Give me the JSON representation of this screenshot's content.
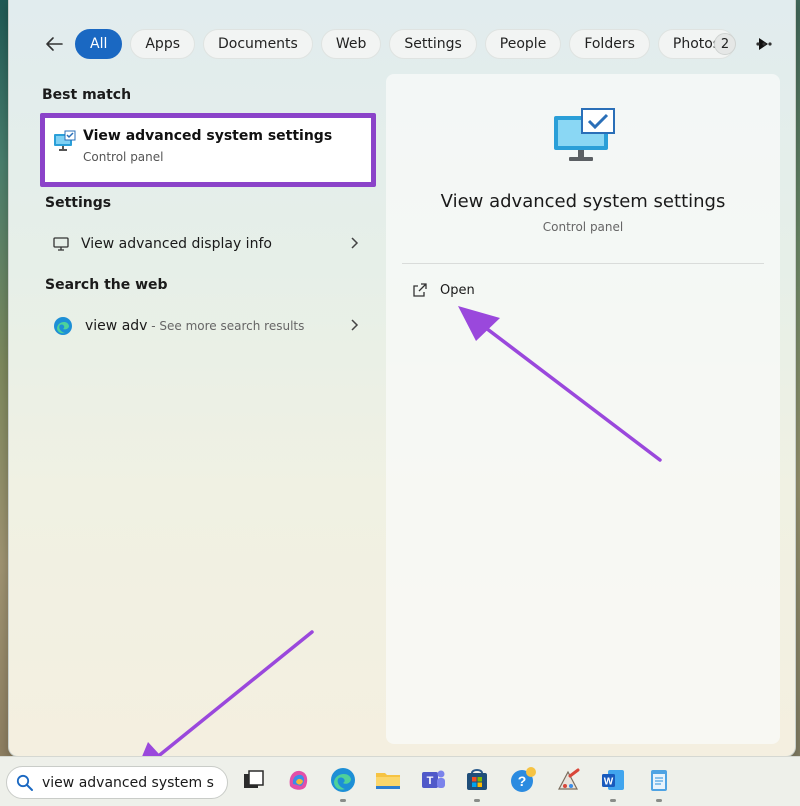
{
  "filter_bar": {
    "chips": [
      "All",
      "Apps",
      "Documents",
      "Web",
      "Settings",
      "People",
      "Folders",
      "Photos"
    ],
    "active_chip": "All",
    "badge_count": "2"
  },
  "best_match": {
    "heading": "Best match",
    "title": "View advanced system settings",
    "subtitle": "Control panel"
  },
  "settings_section": {
    "heading": "Settings",
    "item_label": "View advanced display info"
  },
  "web_section": {
    "heading": "Search the web",
    "query": "view adv",
    "hint": " - See more search results"
  },
  "detail_pane": {
    "title": "View advanced system settings",
    "subtitle": "Control panel",
    "action_open": "Open"
  },
  "taskbar": {
    "search_text": "view advanced system setti",
    "apps": [
      "task-view-icon",
      "copilot-icon",
      "edge-icon",
      "file-explorer-icon",
      "teams-icon",
      "microsoft-store-icon",
      "help-icon",
      "paint-icon",
      "word-icon",
      "notepad-icon"
    ]
  },
  "colors": {
    "accent": "#1a68c2",
    "highlight": "#8b43c9"
  }
}
